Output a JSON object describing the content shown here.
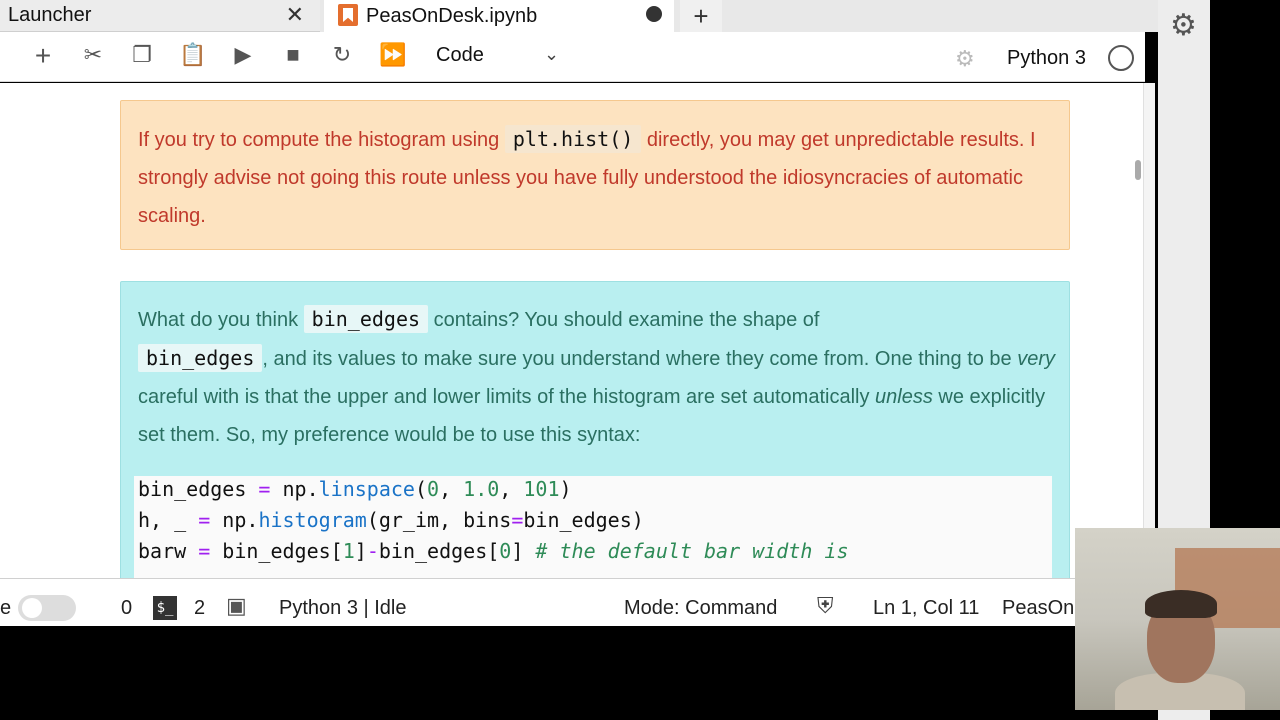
{
  "tabs": {
    "launcher": "Launcher",
    "notebook": "PeasOnDesk.ipynb",
    "add": "+"
  },
  "toolbar": {
    "cell_type": "Code",
    "kernel": "Python 3",
    "icons": [
      "add-cell-icon",
      "cut-icon",
      "copy-icon",
      "paste-icon",
      "run-icon",
      "stop-icon",
      "restart-icon",
      "run-all-icon"
    ]
  },
  "warning": {
    "pre": "If you try to compute the histogram using ",
    "code": "plt.hist()",
    "post": " directly, you may get unpredictable results. I strongly advise not going this route unless you have fully understood the idiosyncracies of automatic scaling."
  },
  "info": {
    "p1_pre": "What do you think ",
    "p1_code": "bin_edges",
    "p1_mid": " contains? You should examine the shape of ",
    "p1_code2": "bin_edges",
    "p1_post": ", and its values to make sure you understand where they come from. One thing to be ",
    "very": "very",
    "p1_mid2": " careful with is that the upper and lower limits of the histogram are set automatically ",
    "unless": "unless",
    "p1_end": " we explicitly set them. So, my preference would be to use this syntax:"
  },
  "code": {
    "l1_var": "bin_edges ",
    "l1_eq": "=",
    "l1_np": " np.",
    "l1_fn": "linspace",
    "l1_open": "(",
    "l1_a": "0",
    "l1_c1": ", ",
    "l1_b": "1.0",
    "l1_c2": ", ",
    "l1_n": "101",
    "l1_close": ")",
    "l2_var": "h, _ ",
    "l2_eq": "=",
    "l2_np": " np.",
    "l2_fn": "histogram",
    "l2_args": "(gr_im, bins",
    "l2_eq2": "=",
    "l2_end": "bin_edges)",
    "l3_var": "barw ",
    "l3_eq": "=",
    "l3_a": " bin_edges[",
    "l3_one": "1",
    "l3_b": "]",
    "l3_minus": "-",
    "l3_c": "bin_edges[",
    "l3_zero": "0",
    "l3_d": "] ",
    "l3_cmt": "# the default bar width is"
  },
  "status": {
    "mode_prefix": "e",
    "zero": "0",
    "two": "2",
    "kernel_status": "Python 3 | Idle",
    "mode": "Mode: Command",
    "cursor": "Ln 1, Col 11",
    "file": "PeasOn"
  }
}
